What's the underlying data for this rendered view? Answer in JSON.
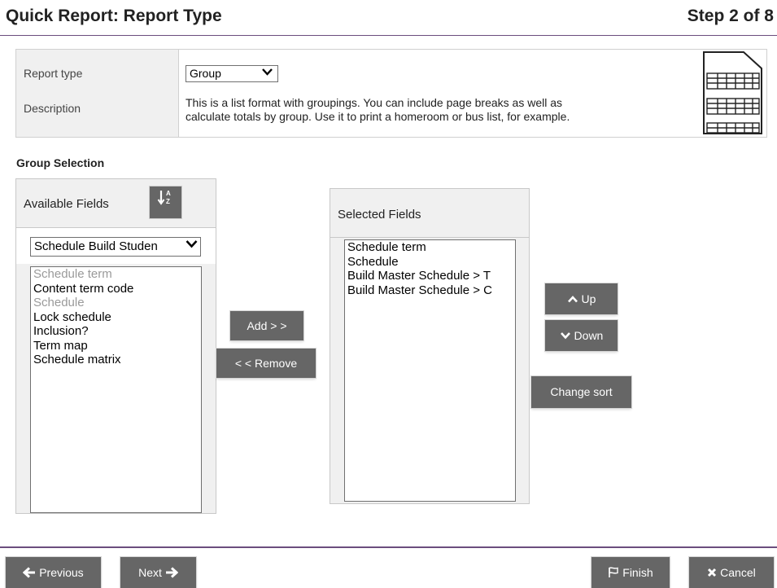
{
  "header": {
    "title": "Quick Report: Report Type",
    "step": "Step 2 of 8"
  },
  "report": {
    "type_label": "Report type",
    "type_value": "Group",
    "description_label": "Description",
    "description_line1": "This is a list format with groupings. You can include page breaks as well as",
    "description_line2": "calculate totals by group. Use it to print a homeroom or bus list, for example."
  },
  "group_selection": {
    "heading": "Group Selection",
    "available": {
      "title": "Available Fields",
      "sort_icon_text": "A Z",
      "table_value": "Schedule Build Studen",
      "items": [
        {
          "label": "Schedule term",
          "dimmed": true
        },
        {
          "label": "Content term code",
          "dimmed": false
        },
        {
          "label": "Schedule",
          "dimmed": true
        },
        {
          "label": "Lock schedule",
          "dimmed": false
        },
        {
          "label": "Inclusion?",
          "dimmed": false
        },
        {
          "label": "Term map",
          "dimmed": false
        },
        {
          "label": "Schedule matrix",
          "dimmed": false
        }
      ]
    },
    "add_label": "Add > >",
    "remove_label": "< < Remove",
    "selected": {
      "title": "Selected Fields",
      "items": [
        "Schedule term",
        "Schedule",
        "Build Master Schedule > T",
        "Build Master Schedule > C"
      ]
    },
    "up_label": "Up",
    "down_label": "Down",
    "change_sort_label": "Change sort"
  },
  "footer": {
    "previous_label": "Previous",
    "next_label": "Next",
    "finish_label": "Finish",
    "cancel_label": "Cancel"
  },
  "colors": {
    "accent": "#6b4d7e",
    "button": "#666666",
    "panel": "#f0f0f0"
  }
}
